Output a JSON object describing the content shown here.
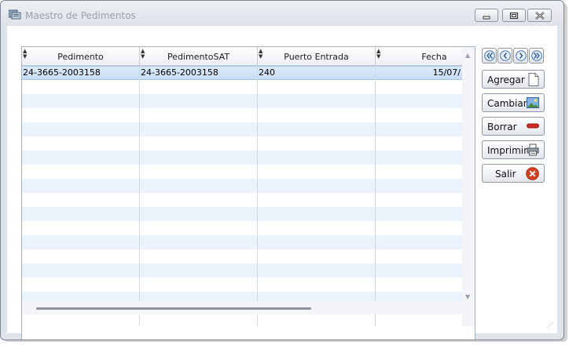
{
  "window": {
    "title": "Maestro de Pedimentos",
    "controls": {
      "minimize": "minimize",
      "maximize": "maximize",
      "close": "close"
    }
  },
  "grid": {
    "columns": [
      "Pedimento",
      "PedimentoSAT",
      "Puerto Entrada",
      "Fecha"
    ],
    "rows": [
      [
        "24-3665-2003158",
        "24-3665-2003158",
        "240",
        "15/07/"
      ]
    ],
    "selected_row": 0
  },
  "navigation": {
    "first": "first-record",
    "prev": "previous-record",
    "next": "next-record",
    "last": "last-record"
  },
  "actions": {
    "agregar": "Agregar",
    "cambiar": "Cambiar",
    "borrar": "Borrar",
    "imprimir": "Imprimir",
    "salir": "Salir"
  },
  "colors": {
    "selection": "#c7dcf3",
    "alt_row": "#eaf2fb",
    "salir_icon": "#d9411e",
    "borrar_icon": "#cc2a22"
  }
}
